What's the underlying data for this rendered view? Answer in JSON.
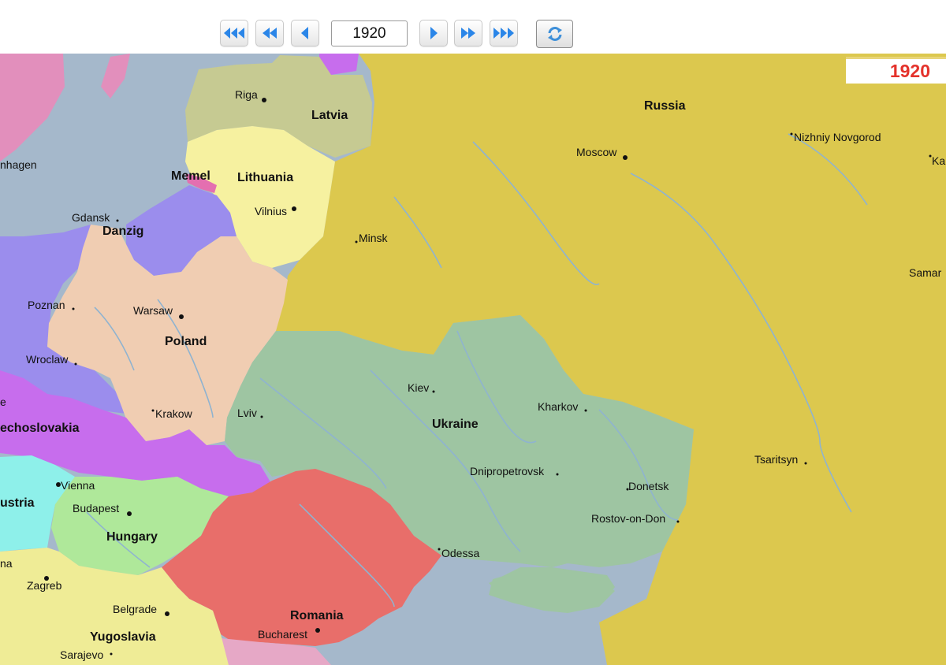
{
  "toolbar": {
    "year_value": "1920",
    "buttons": {
      "first": "fast-rewind-icon",
      "back_fast": "rewind-icon",
      "back": "step-back-icon",
      "forward": "step-forward-icon",
      "forward_fast": "fast-forward-icon",
      "last": "fast-forward-end-icon",
      "refresh": "refresh-icon"
    },
    "accent_color": "#2b86e8"
  },
  "map": {
    "year_badge": "1920",
    "colors": {
      "sea": "#a5b8cb",
      "russia": "#dcc84e",
      "ukraine": "#9ec5a2",
      "poland": "#f0cdb2",
      "lithuania": "#f6f1a0",
      "latvia": "#c6ca92",
      "danzig_germany": "#9b8ded",
      "czechoslovakia": "#c76ded",
      "austria": "#8ef0ea",
      "hungary": "#afe89a",
      "romania": "#e86e6a",
      "yugoslavia": "#efec96",
      "scandinavia": "#e28fbc",
      "river": "#8fb3d0",
      "badge_text": "#e4322b"
    },
    "countries": {
      "russia": "Russia",
      "latvia": "Latvia",
      "lithuania": "Lithuania",
      "memel": "Memel",
      "danzig": "Danzig",
      "poland": "Poland",
      "ukraine": "Ukraine",
      "czechoslovakia": "echoslovakia",
      "austria": "ustria",
      "hungary": "Hungary",
      "romania": "Romania",
      "yugoslavia": "Yugoslavia"
    },
    "cities": {
      "riga": "Riga",
      "moscow": "Moscow",
      "nizhniy_novgorod": "Nizhniy Novgorod",
      "kazan": "Ka",
      "copenhagen": "nhagen",
      "gdansk": "Gdansk",
      "vilnius": "Vilnius",
      "minsk": "Minsk",
      "samara": "Samar",
      "poznan": "Poznan",
      "warsaw": "Warsaw",
      "wroclaw": "Wroclaw",
      "kiev": "Kiev",
      "kharkov": "Kharkov",
      "krakow": "Krakow",
      "lviv": "Lviv",
      "prague": "e",
      "tsaritsyn": "Tsaritsyn",
      "vienna": "Vienna",
      "dnipropetrovsk": "Dnipropetrovsk",
      "donetsk": "Donetsk",
      "budapest": "Budapest",
      "rostov": "Rostov-on-Don",
      "odessa": "Odessa",
      "ljubljana": "na",
      "zagreb": "Zagreb",
      "belgrade": "Belgrade",
      "bucharest": "Bucharest",
      "sarajevo": "Sarajevo"
    }
  }
}
